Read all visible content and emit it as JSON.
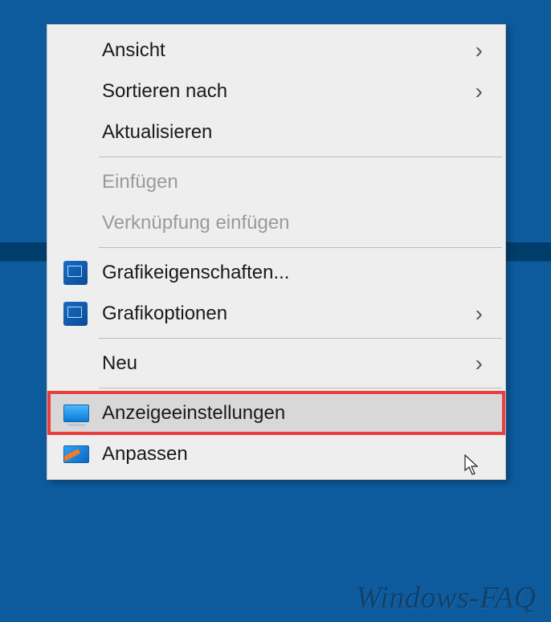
{
  "menu": {
    "items": [
      {
        "label": "Ansicht",
        "hasSubmenu": true
      },
      {
        "label": "Sortieren nach",
        "hasSubmenu": true
      },
      {
        "label": "Aktualisieren"
      },
      {
        "label": "Einfügen",
        "disabled": true
      },
      {
        "label": "Verknüpfung einfügen",
        "disabled": true
      },
      {
        "label": "Grafikeigenschaften...",
        "icon": "intel"
      },
      {
        "label": "Grafikoptionen",
        "icon": "intel",
        "hasSubmenu": true
      },
      {
        "label": "Neu",
        "hasSubmenu": true
      },
      {
        "label": "Anzeigeeinstellungen",
        "icon": "display",
        "highlighted": true
      },
      {
        "label": "Anpassen",
        "icon": "personalize"
      }
    ]
  },
  "arrow_glyph": "›",
  "watermark": "Windows-FAQ"
}
